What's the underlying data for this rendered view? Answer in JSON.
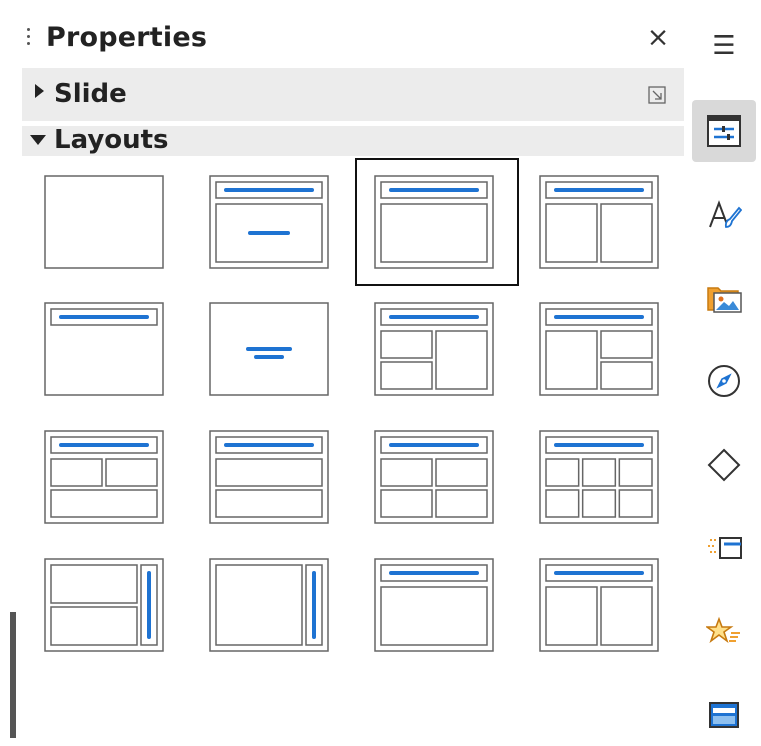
{
  "panel": {
    "title": "Properties",
    "close_glyph": "×"
  },
  "sections": {
    "slide": {
      "label": "Slide",
      "expanded": false
    },
    "layouts": {
      "label": "Layouts",
      "expanded": true
    }
  },
  "layouts": {
    "selected_index": 2,
    "items": [
      "blank-slide",
      "title-content",
      "title-content-1",
      "title-two-content",
      "title-only",
      "centered-text",
      "title-two-content-and-content",
      "title-content-and-two-content",
      "title-two-content-over-content",
      "title-content-over-content",
      "title-four-content",
      "title-six-content",
      "title-vertical-two-content",
      "title-vertical-content",
      "title-content-2",
      "title-two-content-2"
    ]
  },
  "sidebar": {
    "menu_glyph": "☰",
    "active_tab": "properties",
    "tabs": [
      "properties",
      "styles",
      "gallery",
      "navigator",
      "shapes",
      "slide-transition",
      "animation",
      "master-slides"
    ]
  },
  "colors": {
    "accent_blue": "#1e73d2",
    "section_bg": "#ececec",
    "active_tab_bg": "#d9d9d9"
  }
}
